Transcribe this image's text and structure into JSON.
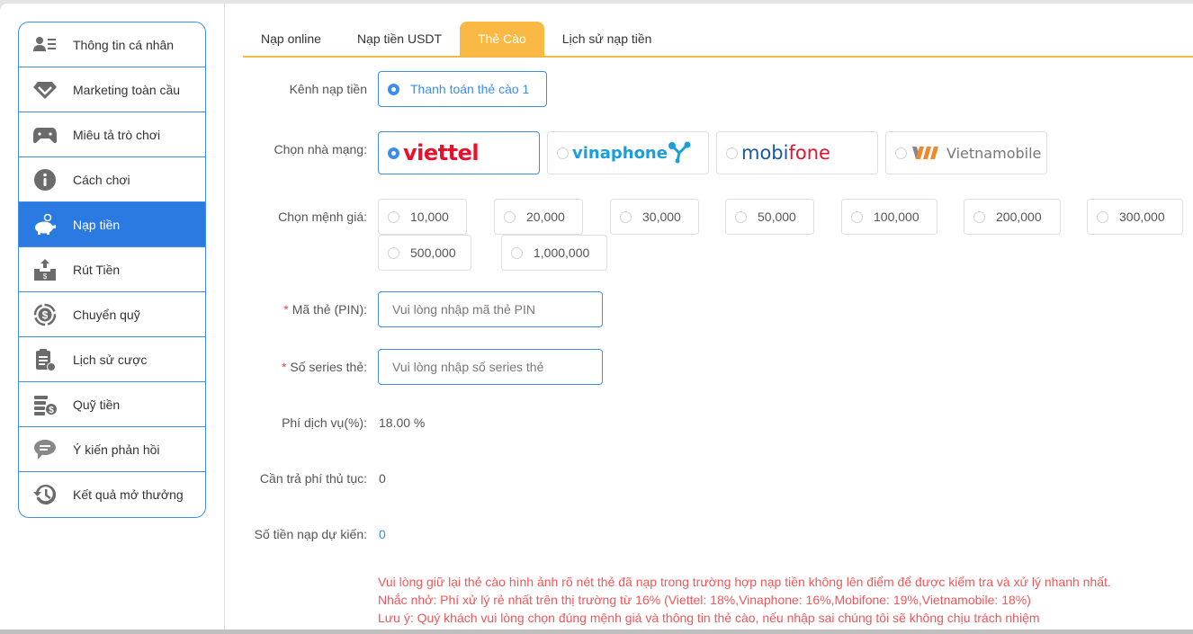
{
  "sidebar": {
    "items": [
      {
        "label": "Thông tin cá nhân",
        "icon": "profile-card-icon"
      },
      {
        "label": "Marketing toàn cầu",
        "icon": "diamond-icon"
      },
      {
        "label": "Miêu tả trò chơi",
        "icon": "gamepad-icon"
      },
      {
        "label": "Cách chơi",
        "icon": "info-icon"
      },
      {
        "label": "Nạp tiền",
        "icon": "piggy-bank-icon",
        "active": true
      },
      {
        "label": "Rút Tiền",
        "icon": "withdraw-icon"
      },
      {
        "label": "Chuyển quỹ",
        "icon": "money-transfer-icon"
      },
      {
        "label": "Lịch sử cược",
        "icon": "clipboard-money-icon"
      },
      {
        "label": "Quỹ tiền",
        "icon": "coins-stack-icon"
      },
      {
        "label": "Ý kiến phản hồi",
        "icon": "chat-bubble-icon"
      },
      {
        "label": "Kết quả mở thưởng",
        "icon": "history-clock-icon"
      }
    ]
  },
  "tabs": [
    {
      "label": "Nạp online"
    },
    {
      "label": "Nạp tiền USDT"
    },
    {
      "label": "Thẻ Cào",
      "active": true
    },
    {
      "label": "Lịch sử nạp tiền"
    }
  ],
  "form": {
    "channel": {
      "label": "Kênh nạp tiền",
      "option": "Thanh toán thẻ cào 1",
      "selected": true
    },
    "carrier": {
      "label": "Chọn nhà mạng:",
      "options": [
        {
          "name": "viettel",
          "text": "viettel",
          "selected": true
        },
        {
          "name": "vinaphone",
          "text": "vinaphone",
          "selected": false
        },
        {
          "name": "mobifone",
          "text_blue": "mobi",
          "text_red": "fone",
          "selected": false
        },
        {
          "name": "vietnamobile",
          "text": "Vietnamobile",
          "selected": false
        }
      ]
    },
    "denomination": {
      "label": "Chọn mệnh giá:",
      "options": [
        "10,000",
        "20,000",
        "30,000",
        "50,000",
        "100,000",
        "200,000",
        "300,000",
        "500,000",
        "1,000,000"
      ]
    },
    "pin": {
      "required_mark": "*",
      "label": "Mã thẻ (PIN):",
      "placeholder": "Vui lòng nhập mã thẻ PIN",
      "value": ""
    },
    "serial": {
      "required_mark": "*",
      "label": "Số series thẻ:",
      "placeholder": "Vui lòng nhập số series thẻ",
      "value": ""
    },
    "service_fee": {
      "label": "Phí dịch vụ(%):",
      "value": "18.00 %"
    },
    "procedure_fee": {
      "label": "Cần trả phí thủ tục:",
      "value": "0"
    },
    "expected_amount": {
      "label": "Số tiền nạp dự kiến:",
      "value": "0"
    }
  },
  "notes": [
    "Vui lòng giữ lại thẻ cào hình ảnh rõ nét thẻ đã nạp trong trường hợp nạp tiền không lên điểm để được kiểm tra và xử lý nhanh nhất.",
    "Nhắc nhở: Phí xử lý rẻ nhất trên thị trường từ 16% (Viettel: 18%,Vinaphone: 16%,Mobifone: 19%,Vietnamobile: 18%)",
    "Lưu ý: Quý khách vui lòng chọn đúng mệnh giá và thông tin thẻ cào, nếu nhập sai chúng tôi sẽ không chịu trách nhiệm"
  ],
  "colors": {
    "primary": "#3e8ee8",
    "active_sidebar": "#2a7ae2",
    "tab_active": "#f9b944",
    "warning_text": "#f0565a",
    "viettel": "#e8112d",
    "vinaphone": "#1a9fdc",
    "mobifone_blue": "#1657a8",
    "vietnamobile_orange": "#f0892c"
  }
}
